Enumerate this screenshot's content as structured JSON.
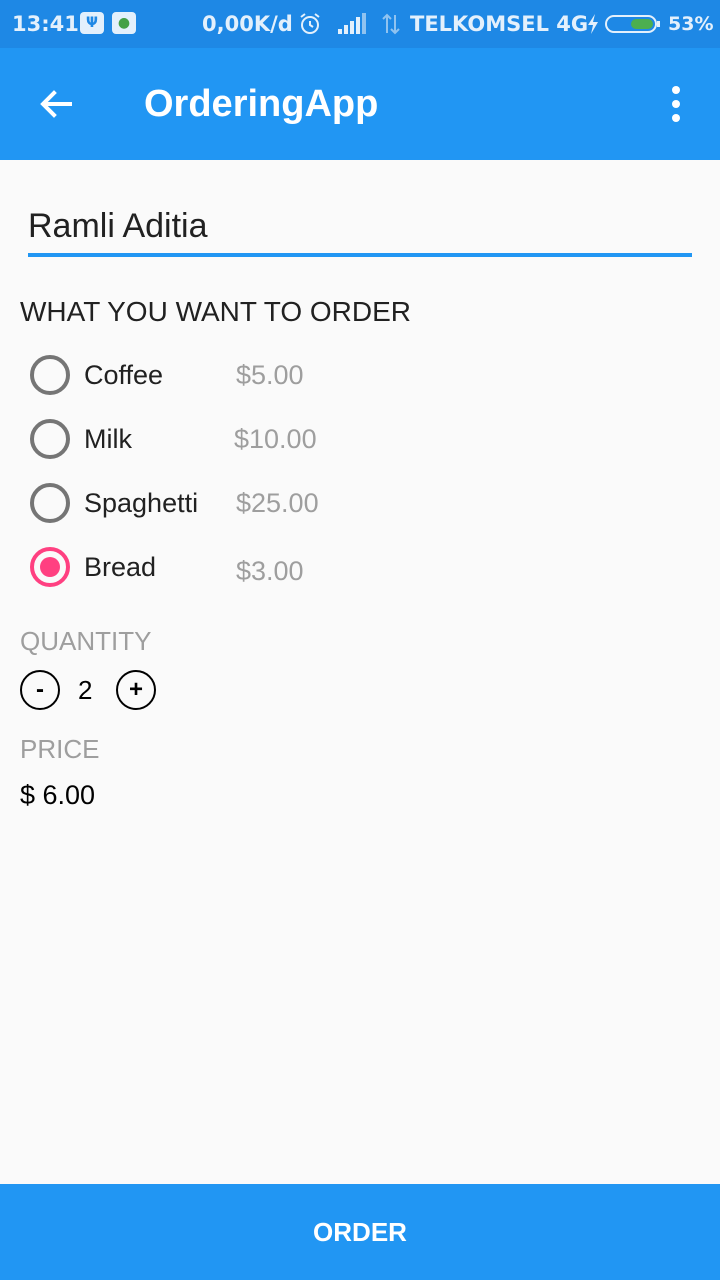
{
  "status_bar": {
    "time": "13:41",
    "network_speed": "0,00K/d",
    "carrier": "TELKOMSEL 4G",
    "battery_percent": "53%"
  },
  "app_bar": {
    "title": "OrderingApp",
    "back_icon": "arrow-back-icon",
    "menu_icon": "more-vert-icon",
    "color": "#2196F3"
  },
  "form": {
    "name_value": "Ramli Aditia",
    "order_heading": "WHAT YOU WANT TO ORDER",
    "items": [
      {
        "label": "Coffee",
        "price": "$5.00",
        "selected": false
      },
      {
        "label": "Milk",
        "price": "$10.00",
        "selected": false
      },
      {
        "label": "Spaghetti",
        "price": "$25.00",
        "selected": false
      },
      {
        "label": "Bread",
        "price": "$3.00",
        "selected": true
      }
    ],
    "quantity_label": "QUANTITY",
    "decrement_label": "-",
    "quantity_value": "2",
    "increment_label": "+",
    "price_label": "PRICE",
    "price_value": "$ 6.00"
  },
  "order_button_label": "ORDER",
  "colors": {
    "primary": "#2196F3",
    "status_bar": "#1E88E5",
    "accent": "#FF4081"
  }
}
